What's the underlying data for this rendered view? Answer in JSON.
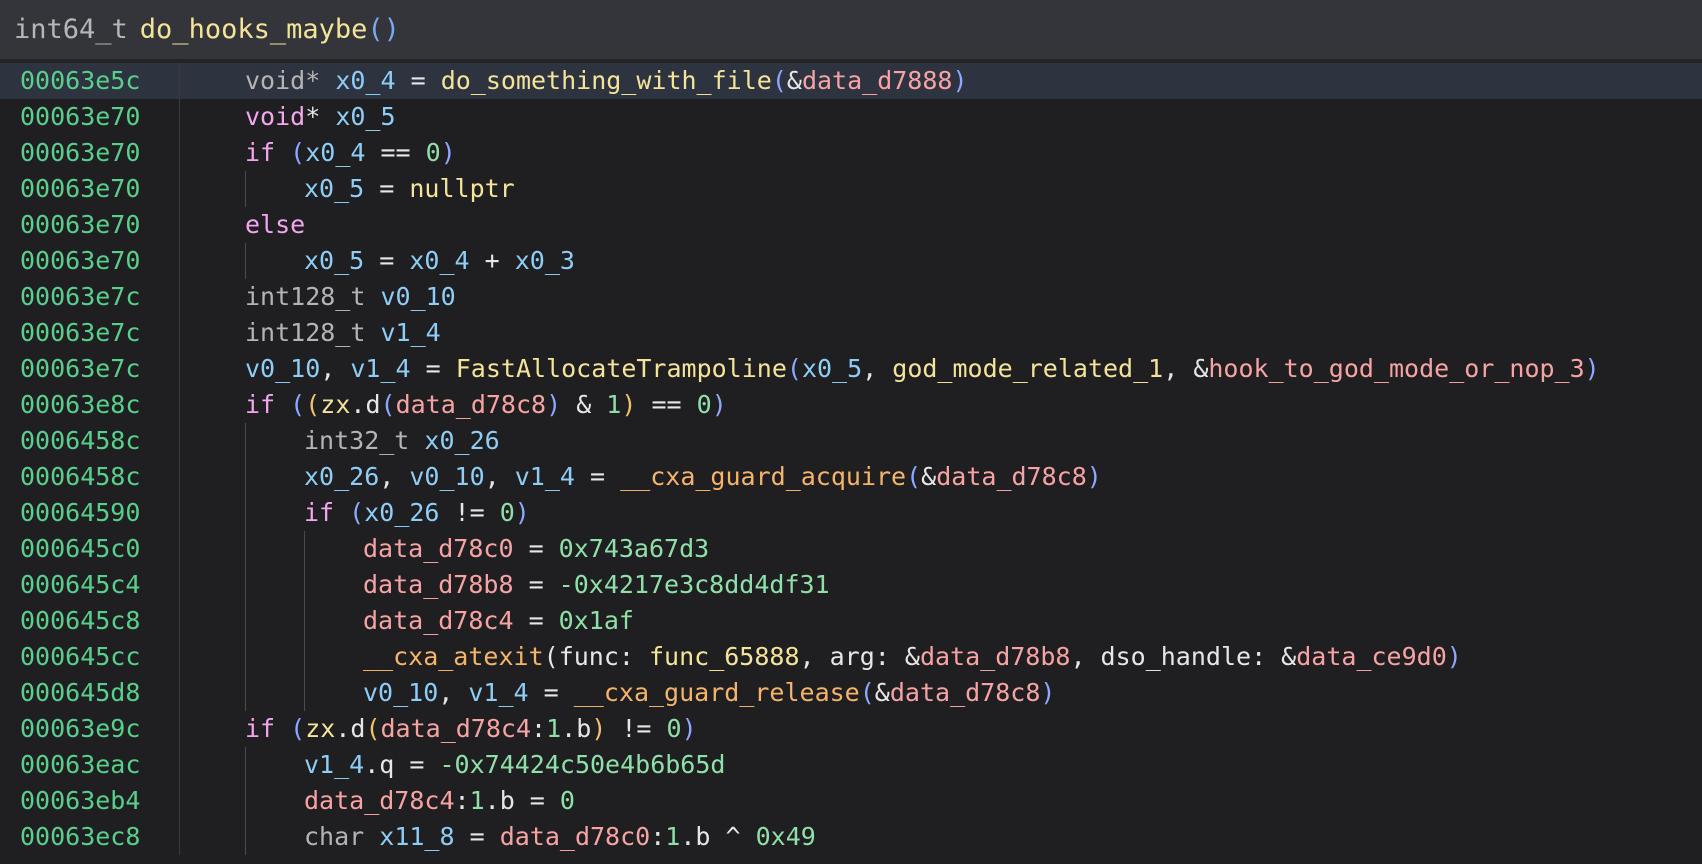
{
  "header": {
    "return_type": "int64_t",
    "function_name": "do_hooks_maybe",
    "parens": "()"
  },
  "lines": [
    {
      "addr": "00063e5c",
      "indent": 0,
      "active": true,
      "tokens": [
        [
          "ty",
          "void* "
        ],
        [
          "var",
          "x0_4"
        ],
        [
          "op",
          " = "
        ],
        [
          "fn",
          "do_something_with_file"
        ],
        [
          "par1",
          "("
        ],
        [
          "op",
          "&"
        ],
        [
          "data",
          "data_d7888"
        ],
        [
          "par1",
          ")"
        ]
      ]
    },
    {
      "addr": "00063e70",
      "indent": 0,
      "tokens": [
        [
          "kwv",
          "void"
        ],
        [
          "txt",
          "* "
        ],
        [
          "var",
          "x0_5"
        ]
      ]
    },
    {
      "addr": "00063e70",
      "indent": 0,
      "tokens": [
        [
          "kw",
          "if "
        ],
        [
          "par1",
          "("
        ],
        [
          "var",
          "x0_4"
        ],
        [
          "op",
          " == "
        ],
        [
          "num",
          "0"
        ],
        [
          "par1",
          ")"
        ]
      ]
    },
    {
      "addr": "00063e70",
      "indent": 1,
      "tokens": [
        [
          "var",
          "x0_5"
        ],
        [
          "op",
          " = "
        ],
        [
          "fn",
          "nullptr"
        ]
      ]
    },
    {
      "addr": "00063e70",
      "indent": 0,
      "tokens": [
        [
          "kw",
          "else"
        ]
      ]
    },
    {
      "addr": "00063e70",
      "indent": 1,
      "tokens": [
        [
          "var",
          "x0_5"
        ],
        [
          "op",
          " = "
        ],
        [
          "var",
          "x0_4"
        ],
        [
          "op",
          " + "
        ],
        [
          "var",
          "x0_3"
        ]
      ]
    },
    {
      "addr": "00063e7c",
      "indent": 0,
      "tokens": [
        [
          "ty",
          "int128_t "
        ],
        [
          "var",
          "v0_10"
        ]
      ]
    },
    {
      "addr": "00063e7c",
      "indent": 0,
      "tokens": [
        [
          "ty",
          "int128_t "
        ],
        [
          "var",
          "v1_4"
        ]
      ]
    },
    {
      "addr": "00063e7c",
      "indent": 0,
      "tokens": [
        [
          "var",
          "v0_10"
        ],
        [
          "op",
          ", "
        ],
        [
          "var",
          "v1_4"
        ],
        [
          "op",
          " = "
        ],
        [
          "fn",
          "FastAllocateTrampoline"
        ],
        [
          "par1",
          "("
        ],
        [
          "var",
          "x0_5"
        ],
        [
          "op",
          ", "
        ],
        [
          "fn",
          "god_mode_related_1"
        ],
        [
          "op",
          ", &"
        ],
        [
          "data",
          "hook_to_god_mode_or_nop_3"
        ],
        [
          "par1",
          ")"
        ]
      ]
    },
    {
      "addr": "00063e8c",
      "indent": 0,
      "tokens": [
        [
          "kw",
          "if "
        ],
        [
          "par1",
          "("
        ],
        [
          "par2",
          "("
        ],
        [
          "fn",
          "zx"
        ],
        [
          "op",
          ".d"
        ],
        [
          "par1",
          "("
        ],
        [
          "data",
          "data_d78c8"
        ],
        [
          "par1",
          ")"
        ],
        [
          "op",
          " & "
        ],
        [
          "num",
          "1"
        ],
        [
          "par2",
          ")"
        ],
        [
          "op",
          " == "
        ],
        [
          "num",
          "0"
        ],
        [
          "par1",
          ")"
        ]
      ]
    },
    {
      "addr": "0006458c",
      "indent": 1,
      "tokens": [
        [
          "ty",
          "int32_t "
        ],
        [
          "var",
          "x0_26"
        ]
      ]
    },
    {
      "addr": "0006458c",
      "indent": 1,
      "tokens": [
        [
          "var",
          "x0_26"
        ],
        [
          "op",
          ", "
        ],
        [
          "var",
          "v0_10"
        ],
        [
          "op",
          ", "
        ],
        [
          "var",
          "v1_4"
        ],
        [
          "op",
          " = "
        ],
        [
          "fn2",
          "__cxa_guard_acquire"
        ],
        [
          "par1",
          "("
        ],
        [
          "op",
          "&"
        ],
        [
          "data",
          "data_d78c8"
        ],
        [
          "par1",
          ")"
        ]
      ]
    },
    {
      "addr": "00064590",
      "indent": 1,
      "tokens": [
        [
          "kw",
          "if "
        ],
        [
          "par1",
          "("
        ],
        [
          "var",
          "x0_26"
        ],
        [
          "op",
          " != "
        ],
        [
          "num",
          "0"
        ],
        [
          "par1",
          ")"
        ]
      ]
    },
    {
      "addr": "000645c0",
      "indent": 2,
      "tokens": [
        [
          "data",
          "data_d78c0"
        ],
        [
          "op",
          " = "
        ],
        [
          "num",
          "0x743a67d3"
        ]
      ]
    },
    {
      "addr": "000645c4",
      "indent": 2,
      "tokens": [
        [
          "data",
          "data_d78b8"
        ],
        [
          "op",
          " = "
        ],
        [
          "num",
          "-0x4217e3c8dd4df31"
        ]
      ]
    },
    {
      "addr": "000645c8",
      "indent": 2,
      "tokens": [
        [
          "data",
          "data_d78c4"
        ],
        [
          "op",
          " = "
        ],
        [
          "num",
          "0x1af"
        ]
      ]
    },
    {
      "addr": "000645cc",
      "indent": 2,
      "tokens": [
        [
          "fn2",
          "__cxa_atexit"
        ],
        [
          "par",
          "("
        ],
        [
          "txt",
          "func: "
        ],
        [
          "fn",
          "func_65888"
        ],
        [
          "txt",
          ", arg: &"
        ],
        [
          "data",
          "data_d78b8"
        ],
        [
          "txt",
          ", dso_handle: &"
        ],
        [
          "data",
          "data_ce9d0"
        ],
        [
          "par1",
          ")"
        ]
      ]
    },
    {
      "addr": "000645d8",
      "indent": 2,
      "tokens": [
        [
          "var",
          "v0_10"
        ],
        [
          "op",
          ", "
        ],
        [
          "var",
          "v1_4"
        ],
        [
          "op",
          " = "
        ],
        [
          "fn2",
          "__cxa_guard_release"
        ],
        [
          "par1",
          "("
        ],
        [
          "op",
          "&"
        ],
        [
          "data",
          "data_d78c8"
        ],
        [
          "par1",
          ")"
        ]
      ]
    },
    {
      "addr": "00063e9c",
      "indent": 0,
      "tokens": [
        [
          "kw",
          "if "
        ],
        [
          "par1",
          "("
        ],
        [
          "fn",
          "zx"
        ],
        [
          "op",
          ".d"
        ],
        [
          "par2",
          "("
        ],
        [
          "data",
          "data_d78c4"
        ],
        [
          "op",
          ":"
        ],
        [
          "num",
          "1"
        ],
        [
          "op",
          ".b"
        ],
        [
          "par2",
          ")"
        ],
        [
          "op",
          " != "
        ],
        [
          "num",
          "0"
        ],
        [
          "par1",
          ")"
        ]
      ]
    },
    {
      "addr": "00063eac",
      "indent": 1,
      "tokens": [
        [
          "var",
          "v1_4"
        ],
        [
          "op",
          ".q = "
        ],
        [
          "num",
          "-0x74424c50e4b6b65d"
        ]
      ]
    },
    {
      "addr": "00063eb4",
      "indent": 1,
      "tokens": [
        [
          "data",
          "data_d78c4"
        ],
        [
          "op",
          ":"
        ],
        [
          "num",
          "1"
        ],
        [
          "op",
          ".b = "
        ],
        [
          "num",
          "0"
        ]
      ]
    },
    {
      "addr": "00063ec8",
      "indent": 1,
      "tokens": [
        [
          "ty",
          "char "
        ],
        [
          "var",
          "x11_8"
        ],
        [
          "op",
          " = "
        ],
        [
          "data",
          "data_d78c0"
        ],
        [
          "op",
          ":"
        ],
        [
          "num",
          "1"
        ],
        [
          "op",
          ".b ^ "
        ],
        [
          "num",
          "0x49"
        ]
      ]
    }
  ]
}
